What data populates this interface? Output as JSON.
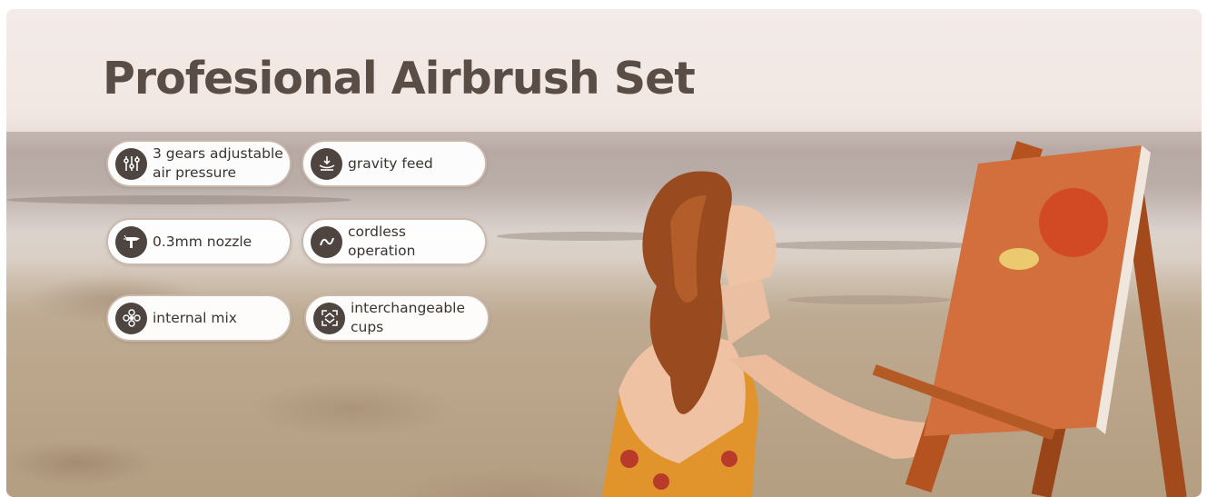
{
  "banner": {
    "title": "Profesional Airbrush Set",
    "features": [
      {
        "label": "3 gears adjustable\nair pressure",
        "icon": "sliders-icon"
      },
      {
        "label": "gravity feed",
        "icon": "gravity-feed-icon"
      },
      {
        "label": "0.3mm nozzle",
        "icon": "airbrush-nozzle-icon"
      },
      {
        "label": "cordless\noperation",
        "icon": "wave-icon"
      },
      {
        "label": "internal mix",
        "icon": "mix-icon"
      },
      {
        "label": "interchangeable\ncups",
        "icon": "swap-icon"
      }
    ],
    "colors": {
      "title": "#5a4d45",
      "icon_bg": "#4e4440",
      "chip_border": "#c9b8ab"
    }
  }
}
